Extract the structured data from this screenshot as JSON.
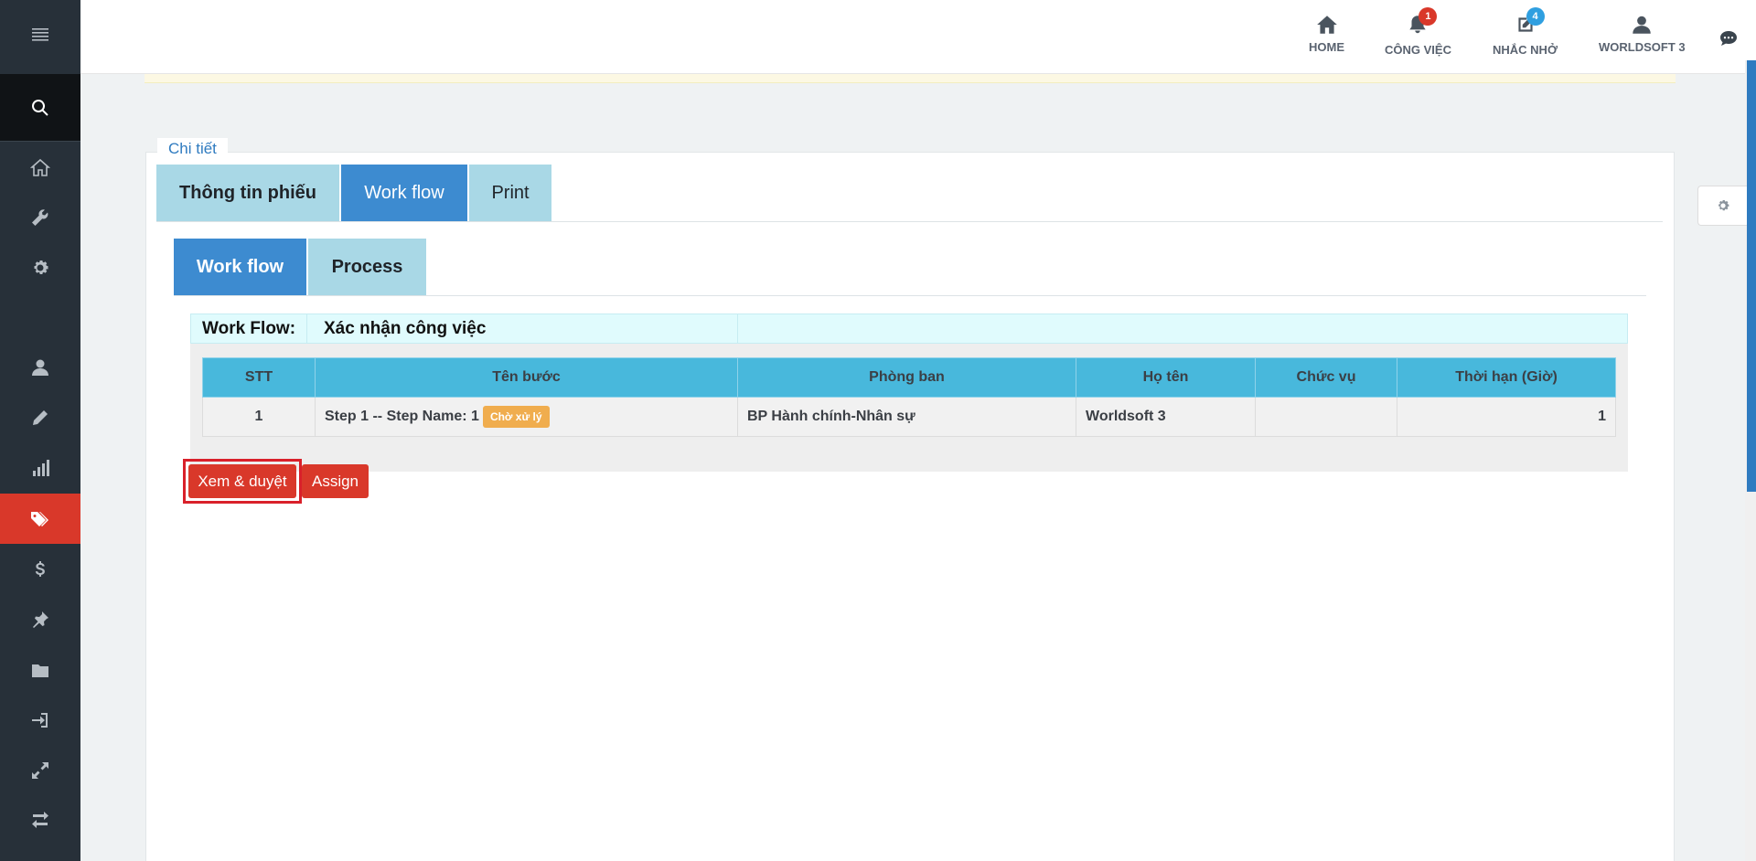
{
  "header": {
    "items": [
      {
        "label": "HOME",
        "icon": "home-icon"
      },
      {
        "label": "CÔNG VIỆC",
        "icon": "bell-icon",
        "badge": "1",
        "badge_color": "#d9382a"
      },
      {
        "label": "NHẮC NHỞ",
        "icon": "edit-icon",
        "badge": "4",
        "badge_color": "#2f9fe0"
      },
      {
        "label": "WORLDSOFT 3",
        "icon": "user-icon"
      }
    ]
  },
  "sidebar": {
    "items": [
      "menu-icon",
      "search-icon",
      "home-icon",
      "wrench-icon",
      "gear-icon",
      "user-icon",
      "pencil-icon",
      "bar-chart-icon",
      "tags-icon",
      "dollar-icon",
      "pin-icon",
      "folder-icon",
      "sign-in-icon",
      "expand-icon",
      "exchange-icon"
    ],
    "active": "tags-icon",
    "active_color": "#d9382a"
  },
  "panel": {
    "legend": "Chi tiết",
    "outer_tabs": [
      "Thông tin phiếu",
      "Work flow",
      "Print"
    ],
    "outer_active": "Work flow",
    "inner_tabs": [
      "Work flow",
      "Process"
    ],
    "inner_active": "Work flow"
  },
  "workflow": {
    "label": "Work Flow:",
    "value": "Xác nhận công việc",
    "columns": [
      "STT",
      "Tên bước",
      "Phòng ban",
      "Họ tên",
      "Chức vụ",
      "Thời hạn (Giờ)"
    ],
    "rows": [
      {
        "stt": "1",
        "step": "Step 1 -- Step Name: 1",
        "status": "Chờ xử lý",
        "department": "BP Hành chính-Nhân sự",
        "name": "Worldsoft 3",
        "position": "",
        "deadline": "1"
      }
    ]
  },
  "actions": {
    "review": "Xem & duyệt",
    "assign": "Assign"
  }
}
